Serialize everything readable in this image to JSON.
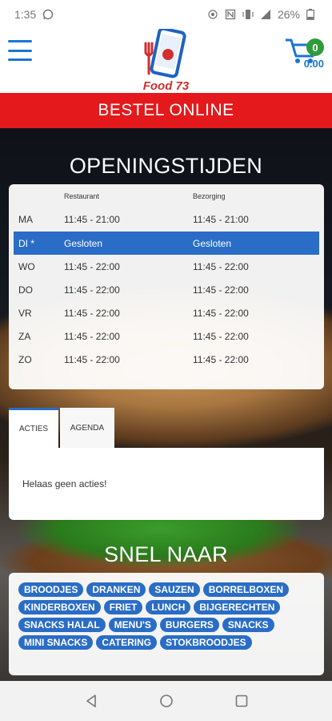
{
  "status_bar": {
    "time": "1:35",
    "battery": "26%"
  },
  "header": {
    "logo_text": "Food 73",
    "cart_count": "0",
    "cart_total": "0.00"
  },
  "bestel_online": "BESTEL ONLINE",
  "opening_hours": {
    "title": "OPENINGSTIJDEN",
    "col_restaurant": "Restaurant",
    "col_bezorging": "Bezorging",
    "rows": [
      {
        "day": "MA",
        "restaurant": "11:45 - 21:00",
        "bezorging": "11:45 - 21:00"
      },
      {
        "day": "DI *",
        "restaurant": "Gesloten",
        "bezorging": "Gesloten"
      },
      {
        "day": "WO",
        "restaurant": "11:45 - 22:00",
        "bezorging": "11:45 - 22:00"
      },
      {
        "day": "DO",
        "restaurant": "11:45 - 22:00",
        "bezorging": "11:45 - 22:00"
      },
      {
        "day": "VR",
        "restaurant": "11:45 - 22:00",
        "bezorging": "11:45 - 22:00"
      },
      {
        "day": "ZA",
        "restaurant": "11:45 - 22:00",
        "bezorging": "11:45 - 22:00"
      },
      {
        "day": "ZO",
        "restaurant": "11:45 - 22:00",
        "bezorging": "11:45 - 22:00"
      }
    ],
    "active_day": "DI *"
  },
  "tabs": {
    "items": [
      "ACTIES",
      "AGENDA"
    ],
    "active": "ACTIES",
    "panel_message": "Helaas geen acties!"
  },
  "snel_naar": {
    "title": "SNEL NAAR",
    "links": [
      "BROODJES",
      "DRANKEN",
      "SAUZEN",
      "BORRELBOXEN",
      "KINDERBOXEN",
      "FRIET",
      "LUNCH",
      "BIJGERECHTEN",
      "SNACKS HALAL",
      "MENU'S",
      "BURGERS",
      "SNACKS",
      "MINI SNACKS",
      "CATERING",
      "STOKBROODJES"
    ]
  },
  "colors": {
    "brand_red": "#e3191b",
    "accent_blue": "#2a6dc6",
    "badge_green": "#2e9c3b"
  }
}
